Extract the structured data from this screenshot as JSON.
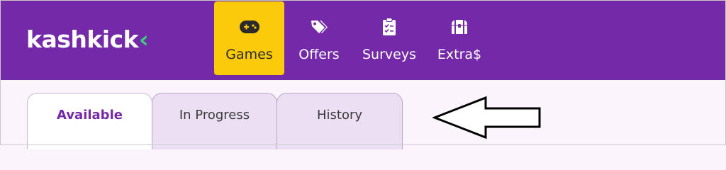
{
  "header": {
    "logo_text": "kashkick",
    "logo_accent": "‹",
    "brand_color": "#7429a8",
    "accent_color": "#39d47a",
    "active_nav_color": "#fbca0a"
  },
  "nav": {
    "items": [
      {
        "label": "Games",
        "icon": "gamepad-icon",
        "active": true
      },
      {
        "label": "Offers",
        "icon": "tags-icon",
        "active": false
      },
      {
        "label": "Surveys",
        "icon": "clipboard-check-icon",
        "active": false
      },
      {
        "label": "Extra$",
        "icon": "treasure-chest-icon",
        "active": false
      }
    ]
  },
  "tabs": {
    "items": [
      {
        "label": "Available",
        "active": true
      },
      {
        "label": "In Progress",
        "active": false
      },
      {
        "label": "History",
        "active": false
      }
    ]
  },
  "annotation": {
    "icon": "left-arrow-annotation-icon"
  }
}
